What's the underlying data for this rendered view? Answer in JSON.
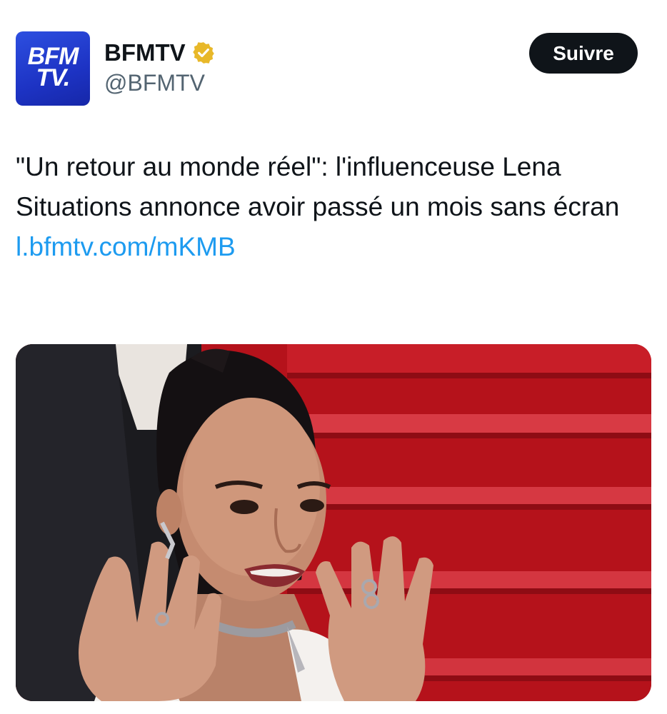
{
  "header": {
    "display_name": "BFMTV",
    "handle": "@BFMTV",
    "follow_label": "Suivre",
    "avatar_lines": [
      "BFM",
      "TV."
    ],
    "verified_icon": "verified-gold-badge-icon"
  },
  "tweet": {
    "text": "\"Un retour au monde réel\": l'influenceuse Lena Situations annonce avoir passé un mois sans écran",
    "link": "l.bfmtv.com/mKMB"
  },
  "colors": {
    "link": "#1d9bf0",
    "follow_button_bg": "#0f1419",
    "avatar_bg": "#1d33c4",
    "verified_gold": "#e8b829",
    "secondary_text": "#536471"
  }
}
